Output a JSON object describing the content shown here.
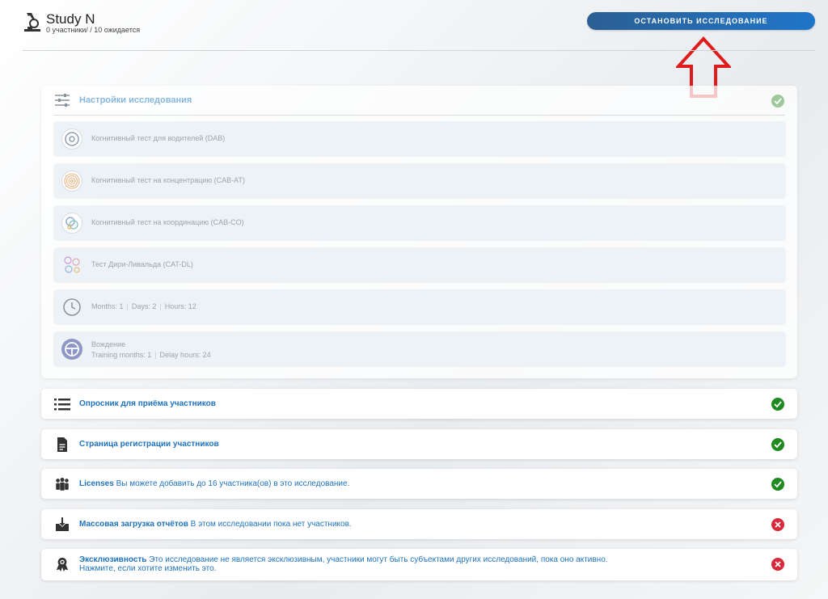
{
  "header": {
    "title": "Study N",
    "subtitle": "0 участники/ / 10 ожидается",
    "stop_button": "ОСТАНОВИТЬ ИССЛЕДОВАНИЕ"
  },
  "settings": {
    "title": "Настройки исследования",
    "items": [
      {
        "label": "Когнитивный тест для водителей (DAB)",
        "icon": "steering-wheel-icon"
      },
      {
        "label": "Когнитивный тест на концентрацию (CAB-AT)",
        "icon": "concentric-circles-icon"
      },
      {
        "label": "Когнитивный тест на координацию (CAB-CO)",
        "icon": "coordination-icon"
      },
      {
        "label": "Тест Дири-Ливальда (CAT-DL)",
        "icon": "circles-icon"
      }
    ],
    "timing": {
      "months": "Months: 1",
      "days": "Days: 2",
      "hours": "Hours: 12"
    },
    "driving": {
      "title": "Вождение",
      "training": "Training months: 1",
      "delay": "Delay hours: 24"
    }
  },
  "cards": {
    "questionnaire": {
      "title": "Опросник для приёма участников",
      "status": "ok"
    },
    "registration": {
      "title": "Страница регистрации участников",
      "status": "ok"
    },
    "licenses": {
      "title": "Licenses",
      "text": "Вы можете добавить до 16 участника(ов) в это исследование.",
      "status": "ok"
    },
    "bulk": {
      "title": "Массовая загрузка отчётов",
      "text": "В этом исследовании пока нет участников.",
      "status": "bad"
    },
    "exclusive": {
      "title": "Эксклюзивность",
      "text": "Это исследование не является эксклюзивным, участники могут быть субъектами других исследований, пока оно активно.",
      "text2": "Нажмите, если хотите изменить это.",
      "status": "bad"
    }
  },
  "colors": {
    "accent": "#1f72bd",
    "ok": "#1f8a1f",
    "bad": "#d9273b",
    "arrow": "#e01b1b"
  }
}
